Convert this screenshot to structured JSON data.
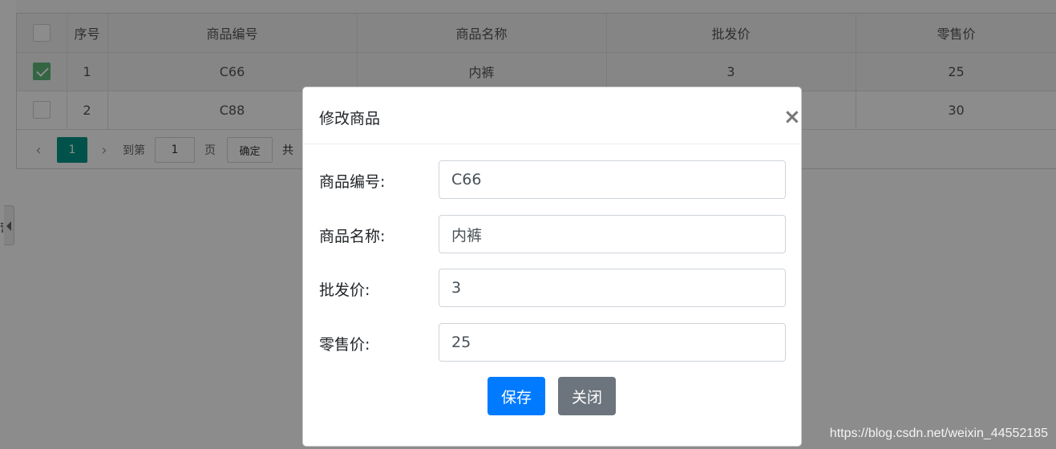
{
  "table": {
    "columns": [
      "",
      "序号",
      "商品编号",
      "商品名称",
      "批发价",
      "零售价"
    ],
    "rows": [
      {
        "checked": true,
        "index": "1",
        "code": "C66",
        "name": "内裤",
        "wholesale": "3",
        "retail": "25"
      },
      {
        "checked": false,
        "index": "2",
        "code": "C88",
        "name": "",
        "wholesale": "",
        "retail": "30"
      }
    ]
  },
  "pager": {
    "current_page": "1",
    "goto_label": "到第",
    "goto_value": "1",
    "page_unit": "页",
    "confirm_label": "确定",
    "total_prefix": "共",
    "prev_icon": "chevron-left-icon",
    "next_icon": "chevron-right-icon"
  },
  "modal": {
    "title": "修改商品",
    "close_icon": "close-icon",
    "fields": [
      {
        "label": "商品编号:",
        "value": "C66"
      },
      {
        "label": "商品名称:",
        "value": "内裤"
      },
      {
        "label": "批发价:",
        "value": "3"
      },
      {
        "label": "零售价:",
        "value": "25"
      }
    ],
    "save_label": "保存",
    "close_label": "关闭"
  },
  "watermark": "https://blog.csdn.net/weixin_44552185",
  "colors": {
    "primary": "#007bff",
    "secondary": "#6c757d",
    "pager_active": "#009688",
    "checkbox_checked": "#5FB878"
  }
}
